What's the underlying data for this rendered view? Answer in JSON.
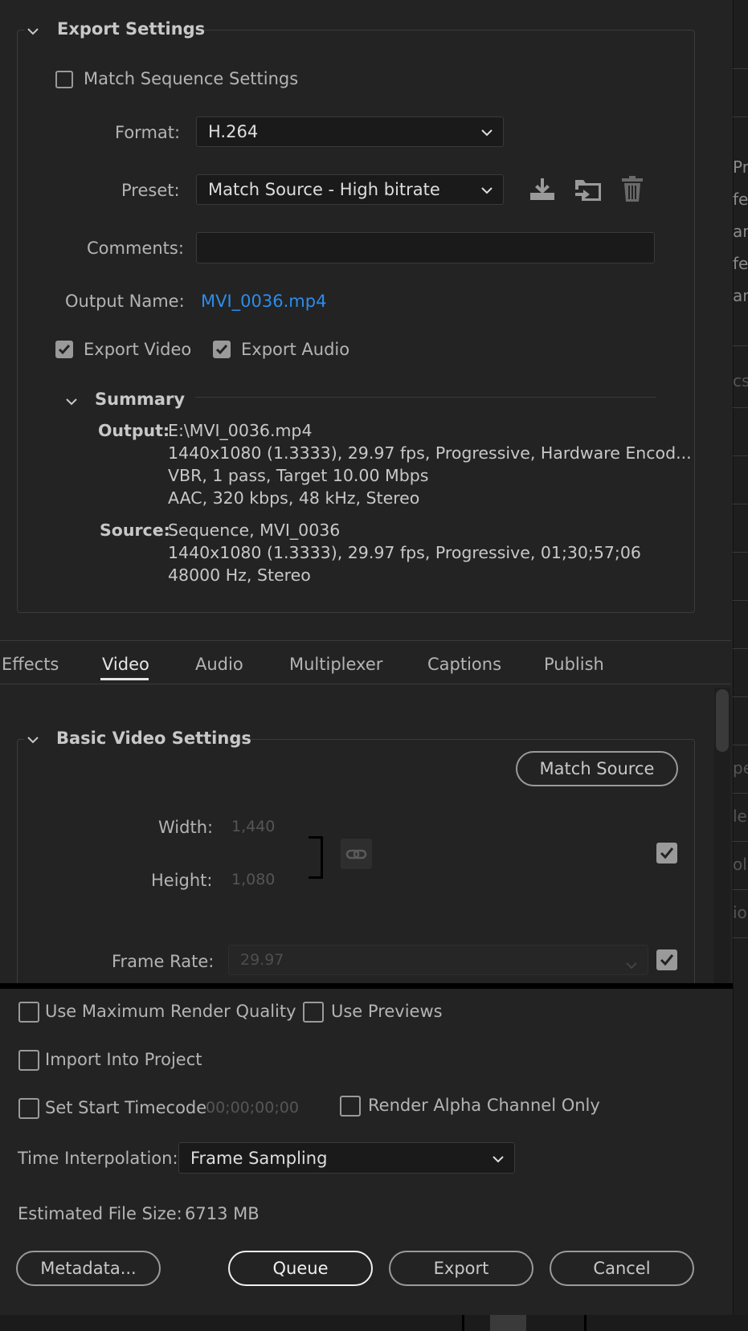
{
  "export_settings": {
    "title": "Export Settings",
    "match_sequence_settings": {
      "label": "Match Sequence Settings",
      "checked": false
    },
    "format": {
      "label": "Format:",
      "value": "H.264"
    },
    "preset": {
      "label": "Preset:",
      "value": "Match Source - High bitrate"
    },
    "preset_icons": [
      "save-preset-icon",
      "import-preset-icon",
      "delete-preset-icon"
    ],
    "comments": {
      "label": "Comments:",
      "value": ""
    },
    "output_name": {
      "label": "Output Name:",
      "value": "MVI_0036.mp4",
      "link_color": "#2d8ceb"
    },
    "export_video": {
      "label": "Export Video",
      "checked": true
    },
    "export_audio": {
      "label": "Export Audio",
      "checked": true
    },
    "summary": {
      "title": "Summary",
      "output_label": "Output:",
      "output_lines": [
        "E:\\MVI_0036.mp4",
        "1440x1080 (1.3333), 29.97 fps, Progressive, Hardware Encod...",
        "VBR, 1 pass, Target 10.00 Mbps",
        "AAC, 320 kbps, 48 kHz, Stereo"
      ],
      "source_label": "Source:",
      "source_lines": [
        "Sequence, MVI_0036",
        "1440x1080 (1.3333), 29.97 fps, Progressive, 01;30;57;06",
        "48000 Hz, Stereo"
      ]
    }
  },
  "tabs": {
    "items": [
      "Effects",
      "Video",
      "Audio",
      "Multiplexer",
      "Captions",
      "Publish"
    ],
    "active": "Video"
  },
  "basic_video": {
    "title": "Basic Video Settings",
    "match_source_label": "Match Source",
    "width": {
      "label": "Width:",
      "value": "1,440"
    },
    "height": {
      "label": "Height:",
      "value": "1,080"
    },
    "width_height_checked": true,
    "frame_rate": {
      "label": "Frame Rate:",
      "value": "29.97",
      "checked": true
    }
  },
  "bottom": {
    "use_max_render_quality": {
      "label": "Use Maximum Render Quality",
      "checked": false
    },
    "use_previews": {
      "label": "Use Previews",
      "checked": false
    },
    "import_into_project": {
      "label": "Import Into Project",
      "checked": false
    },
    "set_start_timecode": {
      "label": "Set Start Timecode",
      "value": "00;00;00;00",
      "checked": false
    },
    "render_alpha_only": {
      "label": "Render Alpha Channel Only",
      "checked": false
    },
    "time_interpolation": {
      "label": "Time Interpolation:",
      "value": "Frame Sampling"
    },
    "estimated_file_size": {
      "label": "Estimated File Size:",
      "value": "6713 MB"
    }
  },
  "buttons": {
    "metadata": "Metadata...",
    "queue": "Queue",
    "export": "Export",
    "cancel": "Cancel"
  },
  "right_strip_fragments": [
    "Pr",
    "fec",
    "an",
    "fec",
    "an",
    "cs",
    "pe",
    "le",
    "ols",
    "io"
  ]
}
